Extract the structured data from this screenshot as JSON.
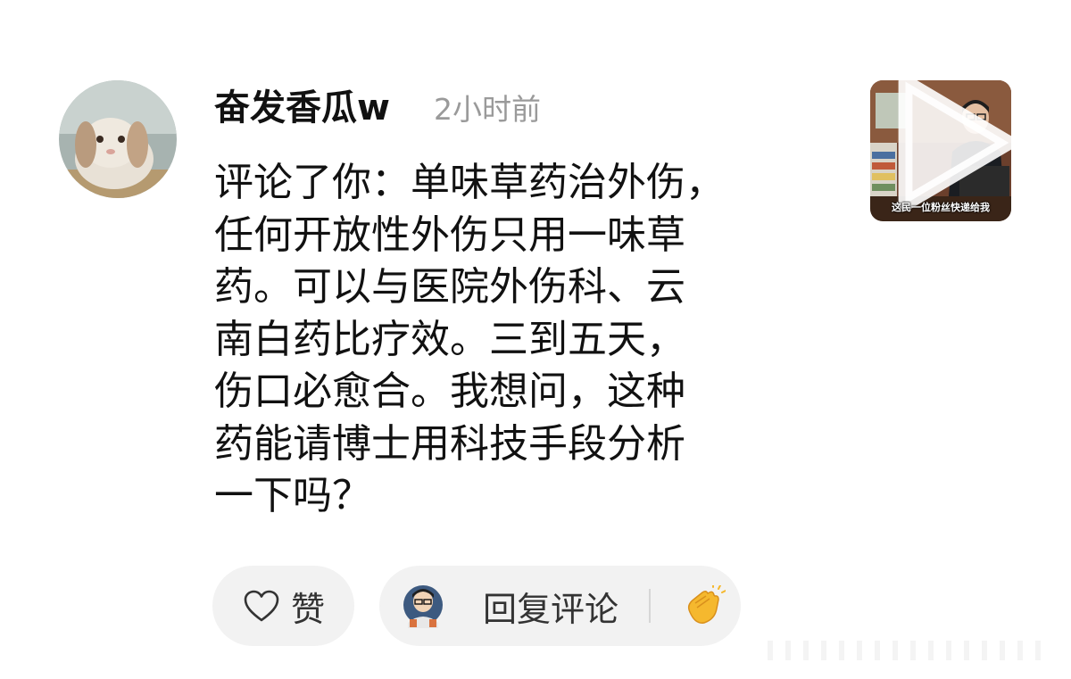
{
  "comment": {
    "username": "奋发香瓜w",
    "time": "2小时前",
    "text_lines": [
      "评论了你：单味草药治外伤，",
      "任何开放性外伤只用一味草",
      "药。可以与医院外伤科、云",
      "南白药比疗效。三到五天，",
      "伤口必愈合。我想问，这种",
      "药能请博士用科技手段分析",
      "一下吗？"
    ]
  },
  "thumbnail": {
    "caption": "这民一位粉丝快递给我"
  },
  "actions": {
    "like_label": "赞",
    "reply_label": "回复评论"
  },
  "colors": {
    "pill_background": "#f2f2f2",
    "time_text": "#9a9a9a"
  },
  "icons": [
    "heart-icon",
    "clap-icon",
    "play-icon"
  ]
}
